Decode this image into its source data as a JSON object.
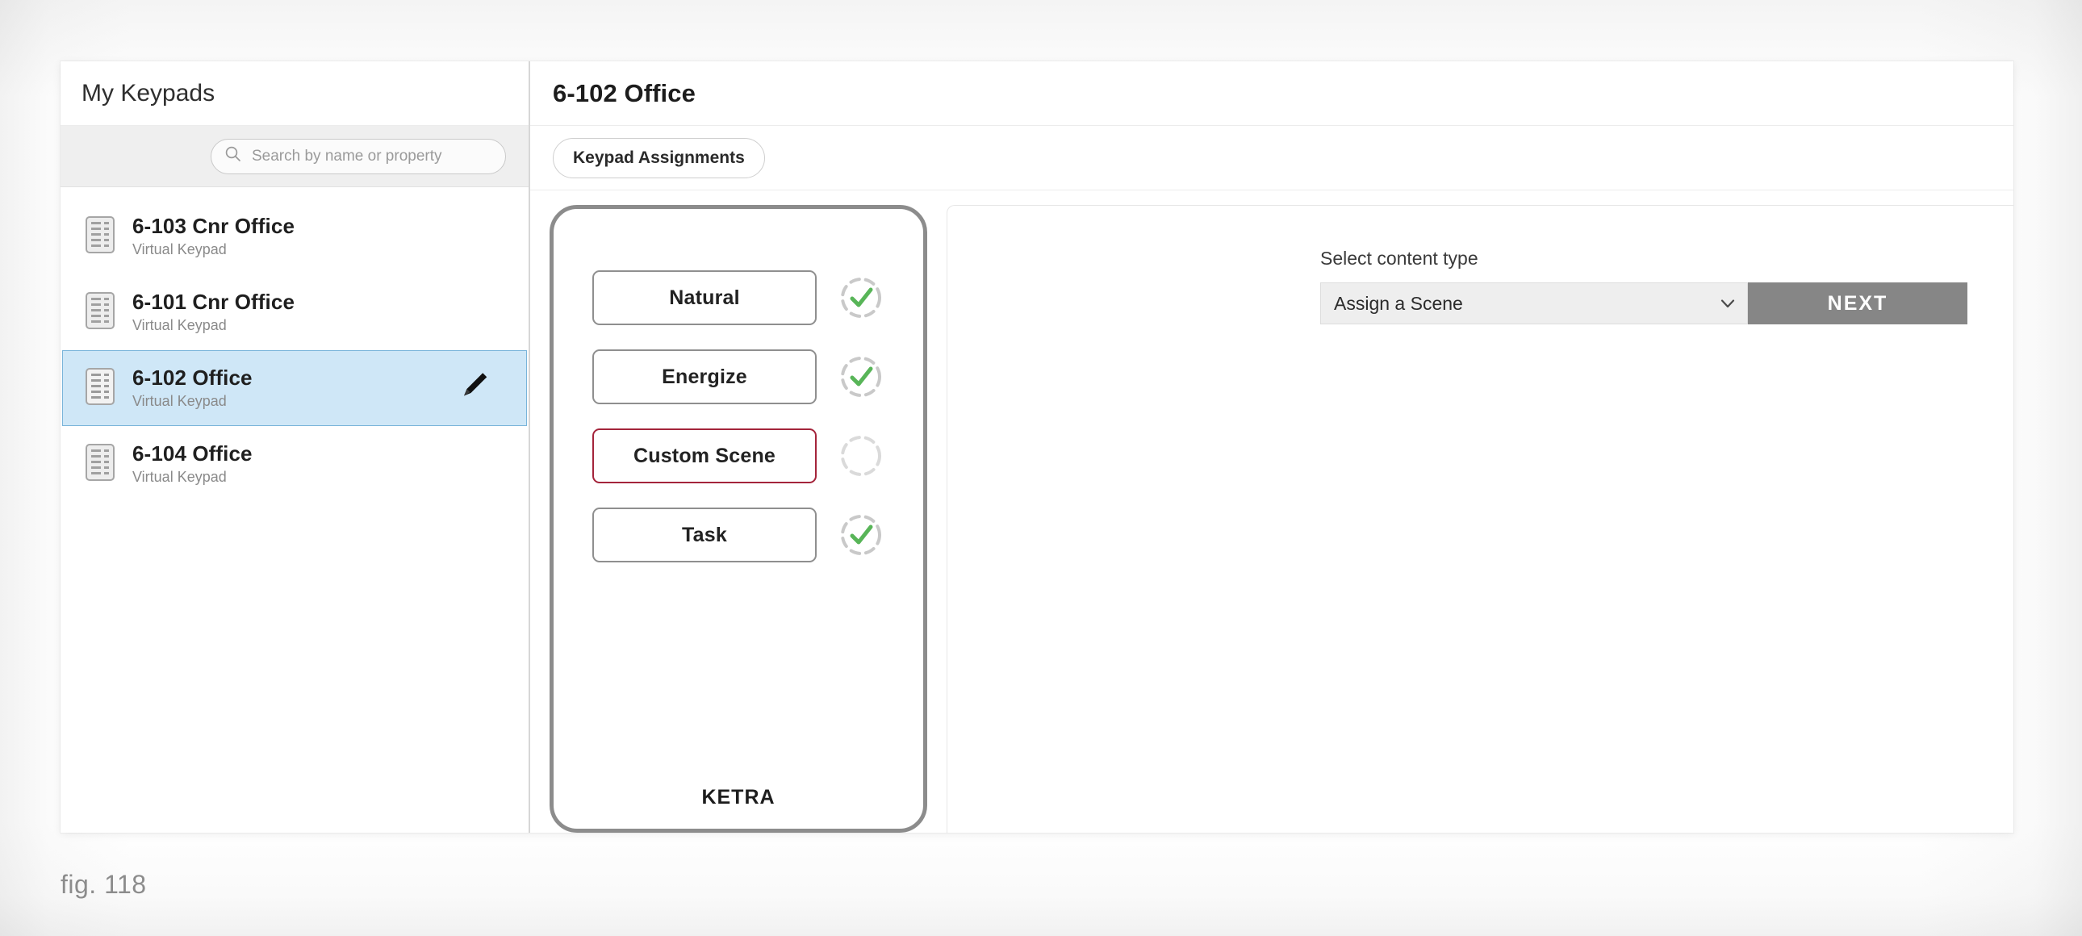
{
  "caption": "fig. 118",
  "sidebar": {
    "title": "My Keypads",
    "search": {
      "placeholder": "Search by name or property",
      "value": "",
      "icon": "search-icon"
    },
    "items": [
      {
        "name": "6-103 Cnr Office",
        "type": "Virtual Keypad",
        "selected": false,
        "icon": "keypad-device-icon"
      },
      {
        "name": "6-101 Cnr Office",
        "type": "Virtual Keypad",
        "selected": false,
        "icon": "keypad-device-icon"
      },
      {
        "name": "6-102 Office",
        "type": "Virtual Keypad",
        "selected": true,
        "icon": "keypad-device-icon",
        "action_icon": "pencil-edit-icon"
      },
      {
        "name": "6-104 Office",
        "type": "Virtual Keypad",
        "selected": false,
        "icon": "keypad-device-icon"
      }
    ]
  },
  "main": {
    "title": "6-102 Office",
    "tabs": [
      {
        "label": "Keypad Assignments",
        "selected": true
      }
    ]
  },
  "device": {
    "brand": "KETRA",
    "buttons": [
      {
        "label": "Natural",
        "active": false,
        "status": "assigned",
        "status_icon": "dashed-circle-check-icon"
      },
      {
        "label": "Energize",
        "active": false,
        "status": "assigned",
        "status_icon": "dashed-circle-check-icon"
      },
      {
        "label": "Custom Scene",
        "active": true,
        "status": "unassigned",
        "status_icon": "dashed-circle-empty-icon"
      },
      {
        "label": "Task",
        "active": false,
        "status": "assigned",
        "status_icon": "dashed-circle-check-icon"
      }
    ]
  },
  "config": {
    "content_type_label": "Select content type",
    "content_type_value": "Assign a Scene",
    "content_type_options": [
      "Assign a Scene"
    ],
    "caret_icon": "chevron-down-icon",
    "next_label": "NEXT"
  },
  "colors": {
    "selection_blue": "#cfe7f7",
    "selection_border": "#79b4da",
    "active_button_red": "#a4243b",
    "status_green": "#58b558",
    "next_gray": "#868686",
    "device_outline": "#8c8c8c"
  }
}
